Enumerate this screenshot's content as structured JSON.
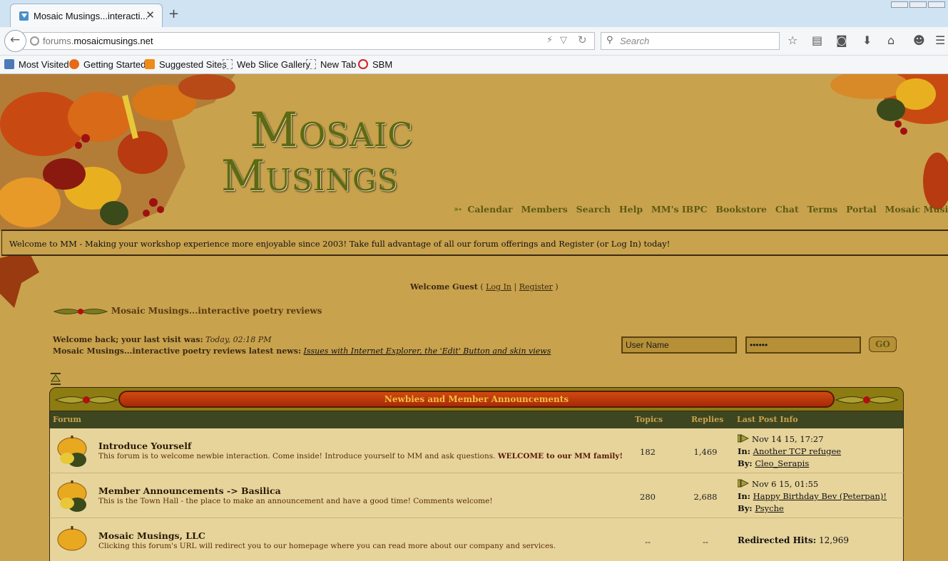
{
  "browser": {
    "tab_title": "Mosaic Musings...interacti...",
    "tab_close": "✕",
    "new_tab": "+",
    "url_prefix": "forums.",
    "url_domain": "mosaicmusings.net",
    "search_placeholder": "Search",
    "bookmarks": [
      {
        "label": "Most Visited",
        "icon": "most-visited-icon",
        "color": "#4a7bb7"
      },
      {
        "label": "Getting Started",
        "icon": "firefox-icon",
        "color": "#e66a18"
      },
      {
        "label": "Suggested Sites",
        "icon": "suggested-sites-icon",
        "color": "#f08a18"
      },
      {
        "label": "Web Slice Gallery",
        "icon": "web-slice-icon",
        "color": "#888888"
      },
      {
        "label": "New Tab",
        "icon": "new-tab-icon",
        "color": "#888888"
      },
      {
        "label": "SBM",
        "icon": "sbm-icon",
        "color": "#d42020"
      }
    ]
  },
  "site": {
    "logo_line1": "Mosaic",
    "logo_line2": "Musings",
    "nav": [
      "Calendar",
      "Members",
      "Search",
      "Help",
      "MM's IBPC",
      "Bookstore",
      "Chat",
      "Terms",
      "Portal",
      "Mosaic Musings"
    ],
    "welcome_bar": "Welcome to MM - Making your workshop experience more enjoyable since 2003! Take full advantage of all our forum offerings and Register (or Log In) today!",
    "guest": {
      "welcome": "Welcome Guest",
      "open": "(",
      "login": "Log In",
      "sep": "|",
      "register": "Register",
      "close": ")"
    },
    "breadcrumb": "Mosaic Musings...interactive poetry reviews",
    "last_visit_label": "Welcome back; your last visit was:",
    "last_visit_value": "Today, 02:18 PM",
    "news_label": "Mosaic Musings...interactive poetry reviews latest news:",
    "news_link": "Issues with Internet Explorer, the 'Edit' Button and skin views",
    "login_user": "User Name",
    "login_pass": "••••••",
    "go": "GO"
  },
  "category": {
    "title": "Newbies and Member Announcements",
    "columns": {
      "forum": "Forum",
      "topics": "Topics",
      "replies": "Replies",
      "last": "Last Post Info"
    },
    "forums": [
      {
        "title": "Introduce Yourself",
        "desc": "This forum is to welcome newbie interaction. Come inside! Introduce yourself to MM and ask questions. ",
        "desc_bold": "WELCOME to our MM family!",
        "topics": "182",
        "replies": "1,469",
        "last_date": "Nov 14 15, 17:27",
        "in_label": "In:",
        "in_link": "Another TCP refugee",
        "by_label": "By:",
        "by_link": "Cleo_Serapis"
      },
      {
        "title": "Member Announcements -> Basilica",
        "desc": "This is the Town Hall - the place to make an announcement and have a good time! Comments welcome!",
        "desc_bold": "",
        "topics": "280",
        "replies": "2,688",
        "last_date": "Nov 6 15, 01:55",
        "in_label": "In:",
        "in_link": "Happy Birthday Bev (Peterpan)!",
        "by_label": "By:",
        "by_link": "Psyche"
      },
      {
        "title": "Mosaic Musings, LLC",
        "desc": "Clicking this forum's URL will redirect you to our homepage where you can read more about our company and services.",
        "desc_bold": "",
        "topics": "--",
        "replies": "--",
        "redirect_label": "Redirected Hits:",
        "redirect_value": "12,969"
      }
    ]
  }
}
